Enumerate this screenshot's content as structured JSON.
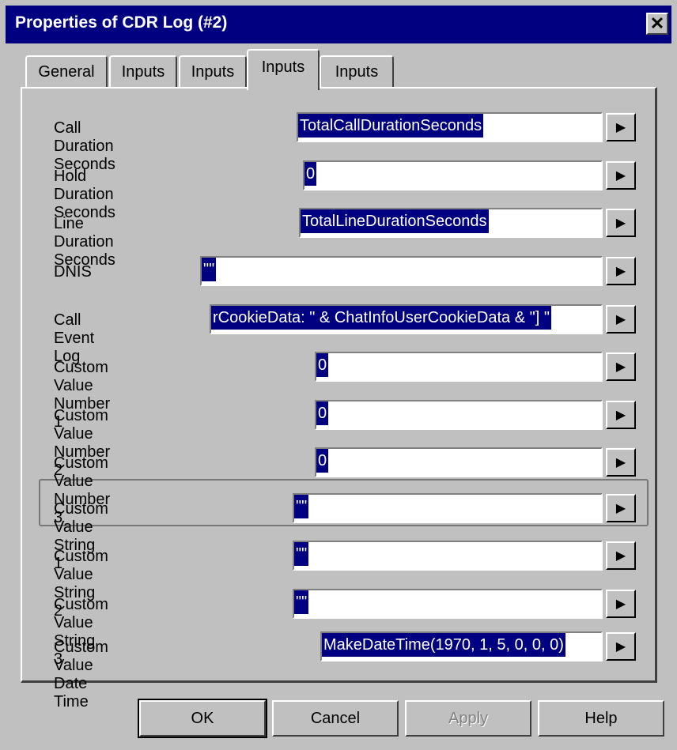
{
  "window": {
    "title": "Properties of CDR Log (#2)",
    "close": "✕"
  },
  "tabs": [
    {
      "label": "General"
    },
    {
      "label": "Inputs"
    },
    {
      "label": "Inputs"
    },
    {
      "label": "Inputs"
    },
    {
      "label": "Inputs"
    }
  ],
  "active_tab": 3,
  "rows": [
    {
      "label": "Call Duration Seconds",
      "value": "TotalCallDurationSeconds"
    },
    {
      "label": "Hold Duration Seconds",
      "value": "0"
    },
    {
      "label": "Line Duration Seconds",
      "value": "TotalLineDurationSeconds"
    },
    {
      "label": "DNIS",
      "value": "\"\""
    },
    {
      "label": "Call Event Log",
      "value": "rCookieData: \" & ChatInfoUserCookieData & \"] \""
    },
    {
      "label": "Custom Value Number 1",
      "value": "0"
    },
    {
      "label": "Custom Value Number 2",
      "value": "0"
    },
    {
      "label": "Custom Value Number 3",
      "value": "0"
    },
    {
      "label": "Custom Value String 1",
      "value": "\"\""
    },
    {
      "label": "Custom Value String 2",
      "value": "\"\""
    },
    {
      "label": "Custom Value String 3",
      "value": "\"\""
    },
    {
      "label": "Custom Value Date Time",
      "value": "MakeDateTime(1970, 1, 5, 0, 0, 0)"
    }
  ],
  "arrow_glyph": "▶",
  "buttons": {
    "ok": "OK",
    "cancel": "Cancel",
    "apply": "Apply",
    "help": "Help"
  }
}
